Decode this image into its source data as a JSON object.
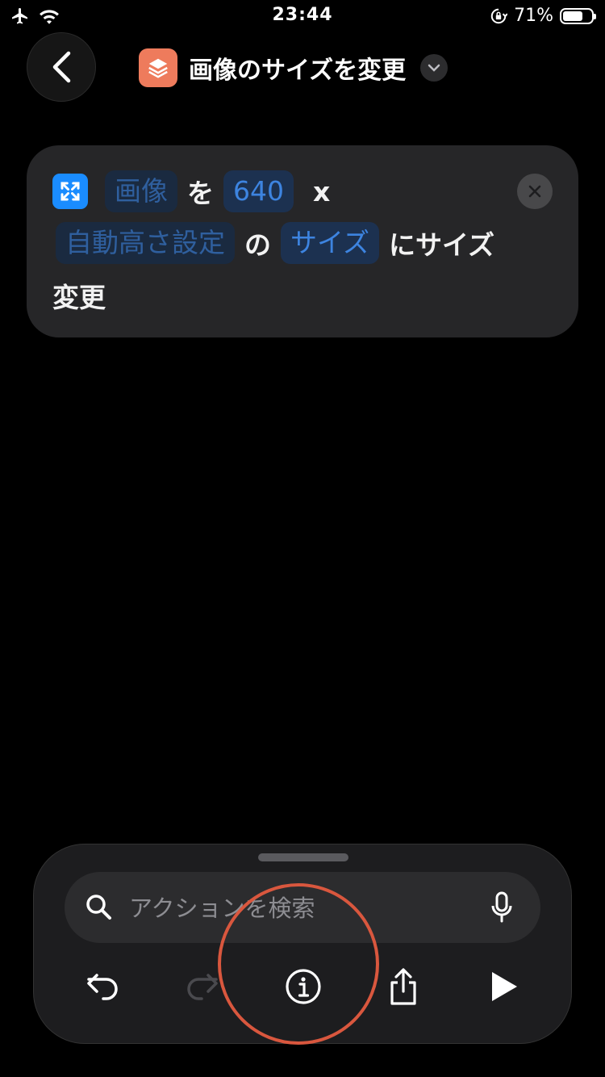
{
  "status_bar": {
    "time": "23:44",
    "battery_percent": "71%",
    "battery_level": 0.71
  },
  "header": {
    "title": "画像のサイズを変更"
  },
  "action": {
    "image_token": "画像",
    "particle_wo": "を",
    "width_value": "640",
    "times_sign": "x",
    "height_token": "自動高さ設定",
    "particle_no": "の",
    "size_token": "サイズ",
    "suffix": "にサイズ",
    "suffix_line2": "変更"
  },
  "search": {
    "placeholder": "アクションを検索"
  },
  "colors": {
    "accent_blue": "#3d84e0",
    "app_icon": "#ee7b5c",
    "action_icon": "#1a8cff",
    "highlight": "#d9573e"
  },
  "icons": [
    "airplane-icon",
    "wifi-icon",
    "orientation-lock-icon",
    "battery-icon",
    "back-chevron-icon",
    "layers-icon",
    "chevron-down-icon",
    "resize-icon",
    "close-icon",
    "search-icon",
    "microphone-icon",
    "undo-icon",
    "redo-icon",
    "info-icon",
    "share-icon",
    "play-icon"
  ]
}
